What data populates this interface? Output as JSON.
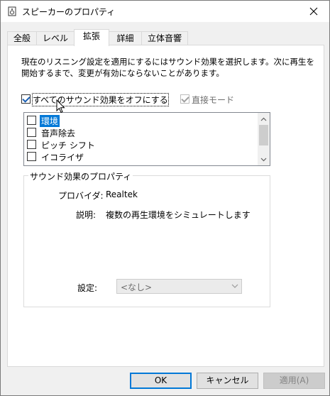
{
  "window": {
    "title": "スピーカーのプロパティ"
  },
  "tabs": [
    {
      "label": "全般"
    },
    {
      "label": "レベル"
    },
    {
      "label": "拡張"
    },
    {
      "label": "詳細"
    },
    {
      "label": "立体音響"
    }
  ],
  "active_tab": "拡張",
  "description": "現在のリスニング設定を適用にするにはサウンド効果を選択します。次に再生を開始するまで、変更が有効にならないことがあります。",
  "disable_all": {
    "label": "すべてのサウンド効果をオフにする",
    "checked": true
  },
  "immediate_mode": {
    "label": "直接モード",
    "checked": true,
    "enabled": false
  },
  "effects": [
    {
      "label": "環境",
      "checked": false,
      "selected": true
    },
    {
      "label": "音声除去",
      "checked": false
    },
    {
      "label": "ピッチ シフト",
      "checked": false
    },
    {
      "label": "イコライザ",
      "checked": false
    }
  ],
  "properties": {
    "group_title": "サウンド効果のプロパティ",
    "provider_label": "プロバイダ:",
    "provider_value": "Realtek",
    "description_label": "説明:",
    "description_value": "複数の再生環境をシミュレートします",
    "setting_label": "設定:",
    "setting_value": "<なし>"
  },
  "buttons": {
    "ok": "OK",
    "cancel": "キャンセル",
    "apply": "適用(A)"
  },
  "colors": {
    "accent": "#0078d7",
    "selection": "#0078d7"
  }
}
